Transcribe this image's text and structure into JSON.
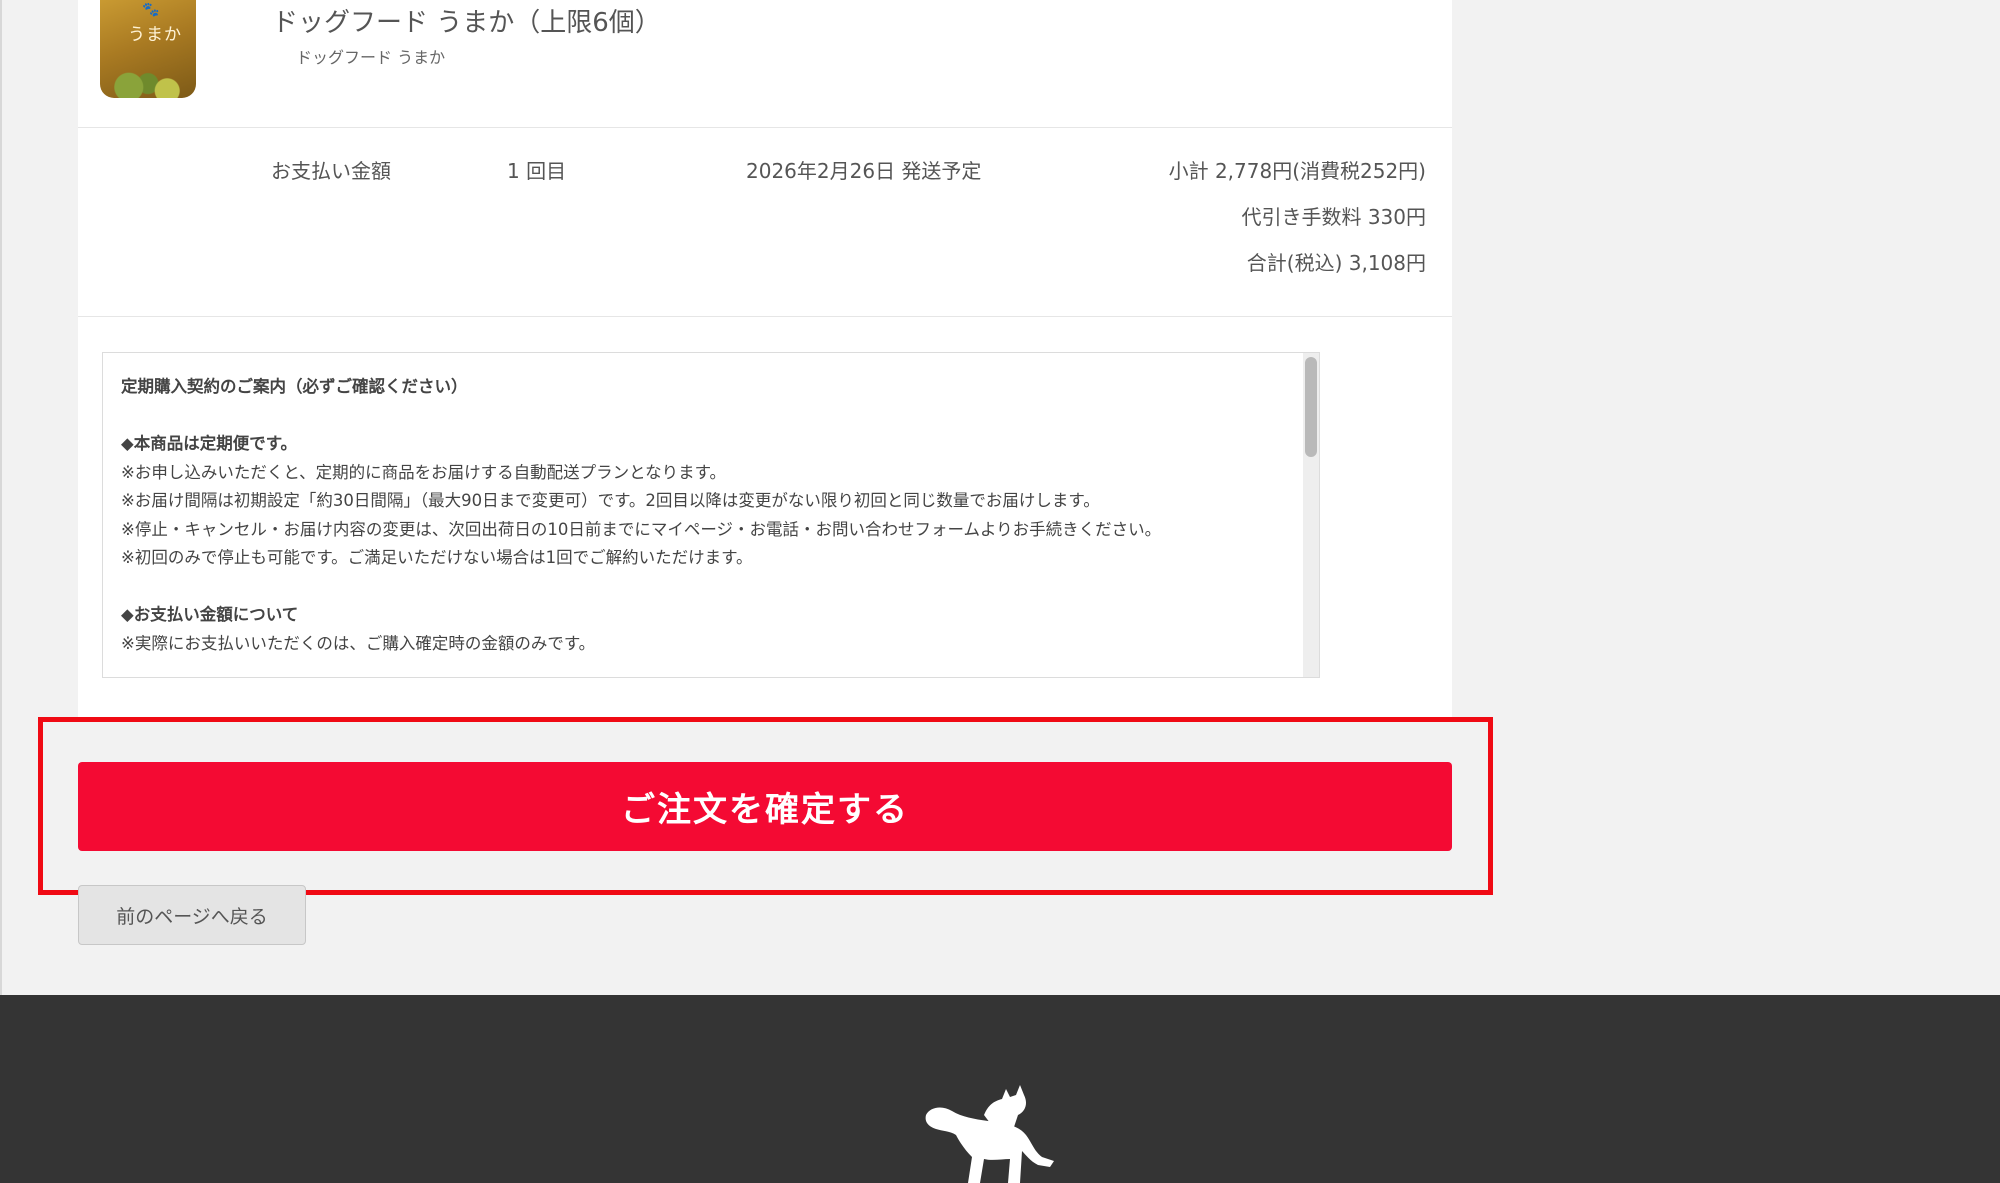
{
  "product": {
    "name": "ドッグフード うまか（上限6個）",
    "sub_name": "ドッグフード うまか",
    "image_brand_text": "うまか",
    "image_alt": "うまか product image"
  },
  "payment": {
    "label": "お支払い金額",
    "count": "1 回目",
    "ship_date": "2026年2月26日 発送予定",
    "subtotal": "小計 2,778円(消費税252円)",
    "cod_fee": "代引き手数料 330円",
    "total": "合計(税込) 3,108円"
  },
  "terms": {
    "heading": "定期購入契約のご案内（必ずご確認ください）",
    "section1_title": "◆本商品は定期便です。",
    "section1_lines": [
      "※お申し込みいただくと、定期的に商品をお届けする自動配送プランとなります。",
      "※お届け間隔は初期設定「約30日間隔」（最大90日まで変更可）です。2回目以降は変更がない限り初回と同じ数量でお届けします。",
      "※停止・キャンセル・お届け内容の変更は、次回出荷日の10日前までにマイページ・お電話・お問い合わせフォームよりお手続きください。",
      "※初回のみで停止も可能です。ご満足いただけない場合は1回でご解約いただけます。"
    ],
    "section2_title": "◆お支払い金額について",
    "section2_lines": [
      "※実際にお支払いいただくのは、ご購入確定時の金額のみです。"
    ]
  },
  "actions": {
    "confirm_label": "ご注文を確定する",
    "back_label": "前のページへ戻る"
  },
  "colors": {
    "confirm_button": "#f40a33",
    "highlight_frame": "#f00a14",
    "footer": "#343434",
    "page_background": "#f2f2f2"
  },
  "icons": {
    "footer_logo": "dog-and-cat-logo-icon"
  }
}
